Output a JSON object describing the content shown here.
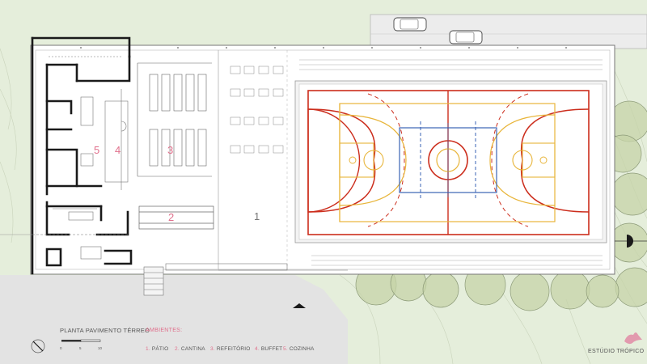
{
  "drawing": {
    "title": "PLANTA PAVIMENTO TÉRREO",
    "legend_heading": "AMBIENTES:",
    "legend_items": [
      {
        "num": "1.",
        "label": "PÁTIO"
      },
      {
        "num": "2.",
        "label": "CANTINA"
      },
      {
        "num": "3.",
        "label": "REFEITÓRIO"
      },
      {
        "num": "4.",
        "label": "BUFFET"
      },
      {
        "num": "5.",
        "label": "COZINHA"
      }
    ],
    "room_numbers": [
      "5",
      "4",
      "3",
      "2",
      "1"
    ],
    "scale_labels": [
      "0",
      "5",
      "10"
    ],
    "brand": "ESTÚDIO TRÓPICO"
  },
  "colors": {
    "room_number": "#e0708c",
    "room_number_patio": "#777777",
    "legend_heading": "#e0708c",
    "legend_number": "#e0708c",
    "court_red": "#cc2d1c",
    "court_yellow": "#e8b53a",
    "court_blue": "#3a63b5",
    "ground_green": "#e5eedb",
    "paving_grey": "#e3e3e3",
    "walls": "#1a1a1a",
    "tree_fill": "#c6d3a8",
    "brand_bird": "#e29aae"
  },
  "icons": [
    "north-arrow-icon",
    "car-icon",
    "tree-icon",
    "bird-logo-icon",
    "entrance-arrow-icon"
  ]
}
